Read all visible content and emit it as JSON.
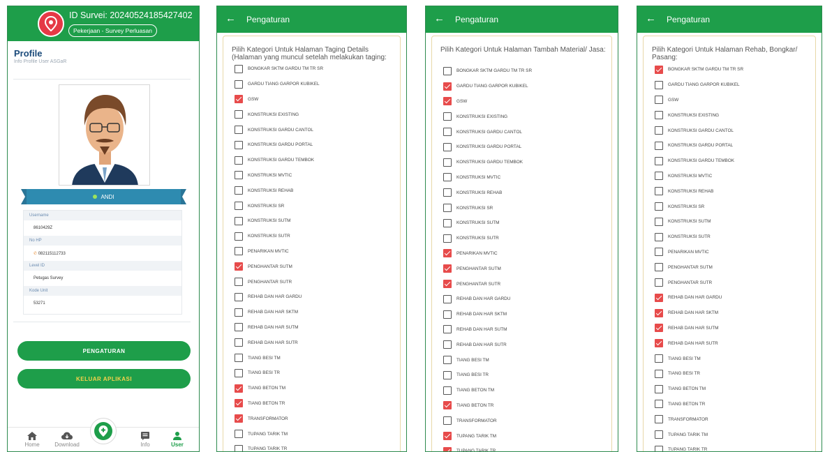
{
  "profile": {
    "survey_id": "ID Survei: 20240524185427402",
    "job_badge": "Pekerjaan - Survey Perluasan",
    "title": "Profile",
    "subtitle": "Info Profile User ASGaR",
    "name": "ANDI",
    "fields": [
      {
        "label": "Username",
        "value": "8610429Z"
      },
      {
        "label": "No HP",
        "value": "082115112733"
      },
      {
        "label": "Level ID",
        "value": "Petugas Survey"
      },
      {
        "label": "Kode Unit",
        "value": "53271"
      }
    ],
    "settings_button": "PENGATURAN",
    "logout_button": "KELUAR APLIKASI",
    "nav": [
      "Home",
      "Download",
      "Info",
      "User"
    ]
  },
  "settings": {
    "header_title": "Pengaturan",
    "back_icon": "←"
  },
  "screens": [
    {
      "heading": "Pilih Kategori Untuk Halaman Taging Details (Halaman yang muncul setelah melakukan taging:",
      "items": [
        {
          "label": "BONGKAR SKTM GARDU TM TR SR",
          "checked": false
        },
        {
          "label": "GARDU TIANG GARPOR KUBIKEL",
          "checked": false
        },
        {
          "label": "GSW",
          "checked": true
        },
        {
          "label": "KONSTRUKSI EXISTING",
          "checked": false
        },
        {
          "label": "KONSTRUKSI GARDU CANTOL",
          "checked": false
        },
        {
          "label": "KONSTRUKSI GARDU PORTAL",
          "checked": false
        },
        {
          "label": "KONSTRUKSI GARDU TEMBOK",
          "checked": false
        },
        {
          "label": "KONSTRUKSI MVTIC",
          "checked": false
        },
        {
          "label": "KONSTRUKSI REHAB",
          "checked": false
        },
        {
          "label": "KONSTRUKSI SR",
          "checked": false
        },
        {
          "label": "KONSTRUKSI SUTM",
          "checked": false
        },
        {
          "label": "KONSTRUKSI SUTR",
          "checked": false
        },
        {
          "label": "PENARIKAN MVTIC",
          "checked": false
        },
        {
          "label": "PENGHANTAR SUTM",
          "checked": true
        },
        {
          "label": "PENGHANTAR SUTR",
          "checked": false
        },
        {
          "label": "REHAB DAN HAR GARDU",
          "checked": false
        },
        {
          "label": "REHAB DAN HAR SKTM",
          "checked": false
        },
        {
          "label": "REHAB DAN HAR SUTM",
          "checked": false
        },
        {
          "label": "REHAB DAN HAR SUTR",
          "checked": false
        },
        {
          "label": "TIANG BESI TM",
          "checked": false
        },
        {
          "label": "TIANG BESI TR",
          "checked": false
        },
        {
          "label": "TIANG BETON TM",
          "checked": true
        },
        {
          "label": "TIANG BETON TR",
          "checked": true
        },
        {
          "label": "TRANSFORMATOR",
          "checked": true
        },
        {
          "label": "TUPANG TARIK TM",
          "checked": false
        },
        {
          "label": "TUPANG TARIK TR",
          "checked": false
        }
      ]
    },
    {
      "heading": "Pilih Kategori Untuk Halaman Tambah Material/ Jasa:",
      "items": [
        {
          "label": "BONGKAR SKTM GARDU TM TR SR",
          "checked": false
        },
        {
          "label": "GARDU TIANG GARPOR KUBIKEL",
          "checked": true
        },
        {
          "label": "GSW",
          "checked": true
        },
        {
          "label": "KONSTRUKSI EXISTING",
          "checked": false
        },
        {
          "label": "KONSTRUKSI GARDU CANTOL",
          "checked": false
        },
        {
          "label": "KONSTRUKSI GARDU PORTAL",
          "checked": false
        },
        {
          "label": "KONSTRUKSI GARDU TEMBOK",
          "checked": false
        },
        {
          "label": "KONSTRUKSI MVTIC",
          "checked": false
        },
        {
          "label": "KONSTRUKSI REHAB",
          "checked": false
        },
        {
          "label": "KONSTRUKSI SR",
          "checked": false
        },
        {
          "label": "KONSTRUKSI SUTM",
          "checked": false
        },
        {
          "label": "KONSTRUKSI SUTR",
          "checked": false
        },
        {
          "label": "PENARIKAN MVTIC",
          "checked": true
        },
        {
          "label": "PENGHANTAR SUTM",
          "checked": true
        },
        {
          "label": "PENGHANTAR SUTR",
          "checked": true
        },
        {
          "label": "REHAB DAN HAR GARDU",
          "checked": false
        },
        {
          "label": "REHAB DAN HAR SKTM",
          "checked": false
        },
        {
          "label": "REHAB DAN HAR SUTM",
          "checked": false
        },
        {
          "label": "REHAB DAN HAR SUTR",
          "checked": false
        },
        {
          "label": "TIANG BESI TM",
          "checked": false
        },
        {
          "label": "TIANG BESI TR",
          "checked": false
        },
        {
          "label": "TIANG BETON TM",
          "checked": false
        },
        {
          "label": "TIANG BETON TR",
          "checked": true
        },
        {
          "label": "TRANSFORMATOR",
          "checked": false
        },
        {
          "label": "TUPANG TARIK TM",
          "checked": true
        },
        {
          "label": "TUPANG TARIK TR",
          "checked": true
        }
      ]
    },
    {
      "heading": "Pilih Kategori Untuk Halaman Rehab, Bongkar/ Pasang:",
      "items": [
        {
          "label": "BONGKAR SKTM GARDU TM TR SR",
          "checked": true
        },
        {
          "label": "GARDU TIANG GARPOR KUBIKEL",
          "checked": false
        },
        {
          "label": "GSW",
          "checked": false
        },
        {
          "label": "KONSTRUKSI EXISTING",
          "checked": false
        },
        {
          "label": "KONSTRUKSI GARDU CANTOL",
          "checked": false
        },
        {
          "label": "KONSTRUKSI GARDU PORTAL",
          "checked": false
        },
        {
          "label": "KONSTRUKSI GARDU TEMBOK",
          "checked": false
        },
        {
          "label": "KONSTRUKSI MVTIC",
          "checked": false
        },
        {
          "label": "KONSTRUKSI REHAB",
          "checked": false
        },
        {
          "label": "KONSTRUKSI SR",
          "checked": false
        },
        {
          "label": "KONSTRUKSI SUTM",
          "checked": false
        },
        {
          "label": "KONSTRUKSI SUTR",
          "checked": false
        },
        {
          "label": "PENARIKAN MVTIC",
          "checked": false
        },
        {
          "label": "PENGHANTAR SUTM",
          "checked": false
        },
        {
          "label": "PENGHANTAR SUTR",
          "checked": false
        },
        {
          "label": "REHAB DAN HAR GARDU",
          "checked": true
        },
        {
          "label": "REHAB DAN HAR SKTM",
          "checked": true
        },
        {
          "label": "REHAB DAN HAR SUTM",
          "checked": true
        },
        {
          "label": "REHAB DAN HAR SUTR",
          "checked": true
        },
        {
          "label": "TIANG BESI TM",
          "checked": false
        },
        {
          "label": "TIANG BESI TR",
          "checked": false
        },
        {
          "label": "TIANG BETON TM",
          "checked": false
        },
        {
          "label": "TIANG BETON TR",
          "checked": false
        },
        {
          "label": "TRANSFORMATOR",
          "checked": false
        },
        {
          "label": "TUPANG TARIK TM",
          "checked": false
        },
        {
          "label": "TUPANG TARIK TR",
          "checked": false
        }
      ]
    }
  ]
}
